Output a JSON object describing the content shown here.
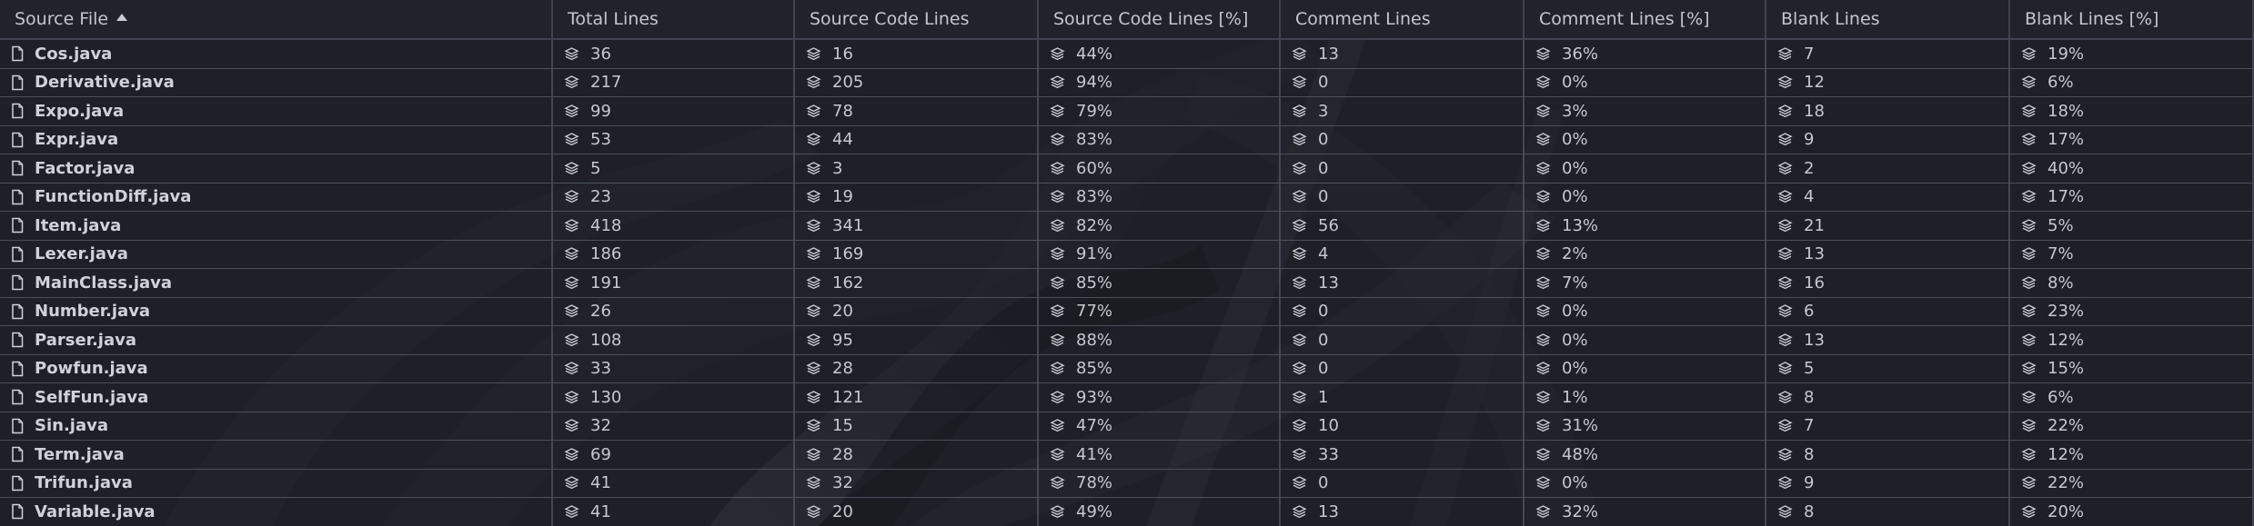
{
  "columns": [
    {
      "label": "Source File",
      "sorted": "ascending"
    },
    {
      "label": "Total Lines"
    },
    {
      "label": "Source Code Lines"
    },
    {
      "label": "Source Code Lines [%]"
    },
    {
      "label": "Comment Lines"
    },
    {
      "label": "Comment Lines [%]"
    },
    {
      "label": "Blank Lines"
    },
    {
      "label": "Blank Lines [%]"
    }
  ],
  "rows": [
    {
      "file": "Cos.java",
      "total": "36",
      "code": "16",
      "code_pct": "44%",
      "comment": "13",
      "comment_pct": "36%",
      "blank": "7",
      "blank_pct": "19%"
    },
    {
      "file": "Derivative.java",
      "total": "217",
      "code": "205",
      "code_pct": "94%",
      "comment": "0",
      "comment_pct": "0%",
      "blank": "12",
      "blank_pct": "6%"
    },
    {
      "file": "Expo.java",
      "total": "99",
      "code": "78",
      "code_pct": "79%",
      "comment": "3",
      "comment_pct": "3%",
      "blank": "18",
      "blank_pct": "18%"
    },
    {
      "file": "Expr.java",
      "total": "53",
      "code": "44",
      "code_pct": "83%",
      "comment": "0",
      "comment_pct": "0%",
      "blank": "9",
      "blank_pct": "17%"
    },
    {
      "file": "Factor.java",
      "total": "5",
      "code": "3",
      "code_pct": "60%",
      "comment": "0",
      "comment_pct": "0%",
      "blank": "2",
      "blank_pct": "40%"
    },
    {
      "file": "FunctionDiff.java",
      "total": "23",
      "code": "19",
      "code_pct": "83%",
      "comment": "0",
      "comment_pct": "0%",
      "blank": "4",
      "blank_pct": "17%"
    },
    {
      "file": "Item.java",
      "total": "418",
      "code": "341",
      "code_pct": "82%",
      "comment": "56",
      "comment_pct": "13%",
      "blank": "21",
      "blank_pct": "5%"
    },
    {
      "file": "Lexer.java",
      "total": "186",
      "code": "169",
      "code_pct": "91%",
      "comment": "4",
      "comment_pct": "2%",
      "blank": "13",
      "blank_pct": "7%"
    },
    {
      "file": "MainClass.java",
      "total": "191",
      "code": "162",
      "code_pct": "85%",
      "comment": "13",
      "comment_pct": "7%",
      "blank": "16",
      "blank_pct": "8%"
    },
    {
      "file": "Number.java",
      "total": "26",
      "code": "20",
      "code_pct": "77%",
      "comment": "0",
      "comment_pct": "0%",
      "blank": "6",
      "blank_pct": "23%"
    },
    {
      "file": "Parser.java",
      "total": "108",
      "code": "95",
      "code_pct": "88%",
      "comment": "0",
      "comment_pct": "0%",
      "blank": "13",
      "blank_pct": "12%"
    },
    {
      "file": "Powfun.java",
      "total": "33",
      "code": "28",
      "code_pct": "85%",
      "comment": "0",
      "comment_pct": "0%",
      "blank": "5",
      "blank_pct": "15%"
    },
    {
      "file": "SelfFun.java",
      "total": "130",
      "code": "121",
      "code_pct": "93%",
      "comment": "1",
      "comment_pct": "1%",
      "blank": "8",
      "blank_pct": "6%"
    },
    {
      "file": "Sin.java",
      "total": "32",
      "code": "15",
      "code_pct": "47%",
      "comment": "10",
      "comment_pct": "31%",
      "blank": "7",
      "blank_pct": "22%"
    },
    {
      "file": "Term.java",
      "total": "69",
      "code": "28",
      "code_pct": "41%",
      "comment": "33",
      "comment_pct": "48%",
      "blank": "8",
      "blank_pct": "12%"
    },
    {
      "file": "Trifun.java",
      "total": "41",
      "code": "32",
      "code_pct": "78%",
      "comment": "0",
      "comment_pct": "0%",
      "blank": "9",
      "blank_pct": "22%"
    },
    {
      "file": "Variable.java",
      "total": "41",
      "code": "20",
      "code_pct": "49%",
      "comment": "13",
      "comment_pct": "32%",
      "blank": "8",
      "blank_pct": "20%"
    }
  ],
  "icons": {
    "file": "file-icon",
    "metric": "stack-icon",
    "sort": "sort-ascending-icon"
  },
  "colors": {
    "background": "#1f2129",
    "text": "#c6c8cf",
    "grid": "#505561"
  }
}
